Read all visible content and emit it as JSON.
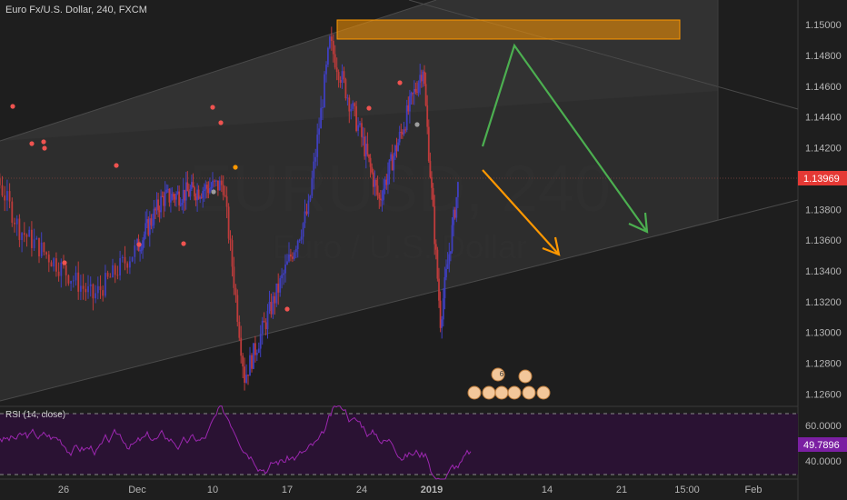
{
  "chart_data": {
    "type": "candlestick",
    "title": "Euro Fx/U.S. Dollar, 240, FXCM",
    "watermark_symbol": "EURUSD, 240",
    "watermark_name": "Euro / U.S. Dollar",
    "current_price": "1.13969",
    "y_ticks": [
      "1.15000",
      "1.14800",
      "1.14600",
      "1.14400",
      "1.14200",
      "1.14000",
      "1.13800",
      "1.13600",
      "1.13400",
      "1.13200",
      "1.13000",
      "1.12800",
      "1.12600"
    ],
    "ylim": [
      1.1252,
      1.1516
    ],
    "x_ticks": [
      "26",
      "Dec",
      "10",
      "17",
      "24",
      "2019",
      "14",
      "21",
      "15:00",
      "Feb"
    ],
    "swing_points": [
      {
        "date": "Nov 20",
        "price": 1.1433
      },
      {
        "date": "Nov 23",
        "price": 1.1367
      },
      {
        "date": "Nov 28",
        "price": 1.1323
      },
      {
        "date": "Dec 4",
        "price": 1.1387
      },
      {
        "date": "Dec 11",
        "price": 1.1396
      },
      {
        "date": "Dec 13",
        "price": 1.1271
      },
      {
        "date": "Dec 19",
        "price": 1.138
      },
      {
        "date": "Dec 21",
        "price": 1.1488
      },
      {
        "date": "Dec 26",
        "price": 1.1386
      },
      {
        "date": "Dec 31",
        "price": 1.1473
      },
      {
        "date": "Jan 2",
        "price": 1.1308
      },
      {
        "date": "Jan 4",
        "price": 1.1395
      }
    ],
    "resistance_zone": [
      1.1488,
      1.1497
    ],
    "rsi": {
      "label": "RSI (14, close)",
      "ticks": [
        "60.0000",
        "40.0000"
      ],
      "value": "49.7896",
      "levels": [
        70,
        30
      ],
      "ylim": [
        27,
        75
      ]
    },
    "colors": {
      "background": "#1e1e1e",
      "up": "#3f3fbf",
      "down": "#bf3b3b",
      "channel": "#2d2d2d",
      "zone": "#ff9800",
      "green_arrow": "#4caf50",
      "orange_arrow": "#ff9800",
      "price_tag": "#e53935",
      "rsi_line": "#9c27b0",
      "rsi_tag": "#7b1fa2",
      "rsi_band": "#2a1233"
    }
  }
}
